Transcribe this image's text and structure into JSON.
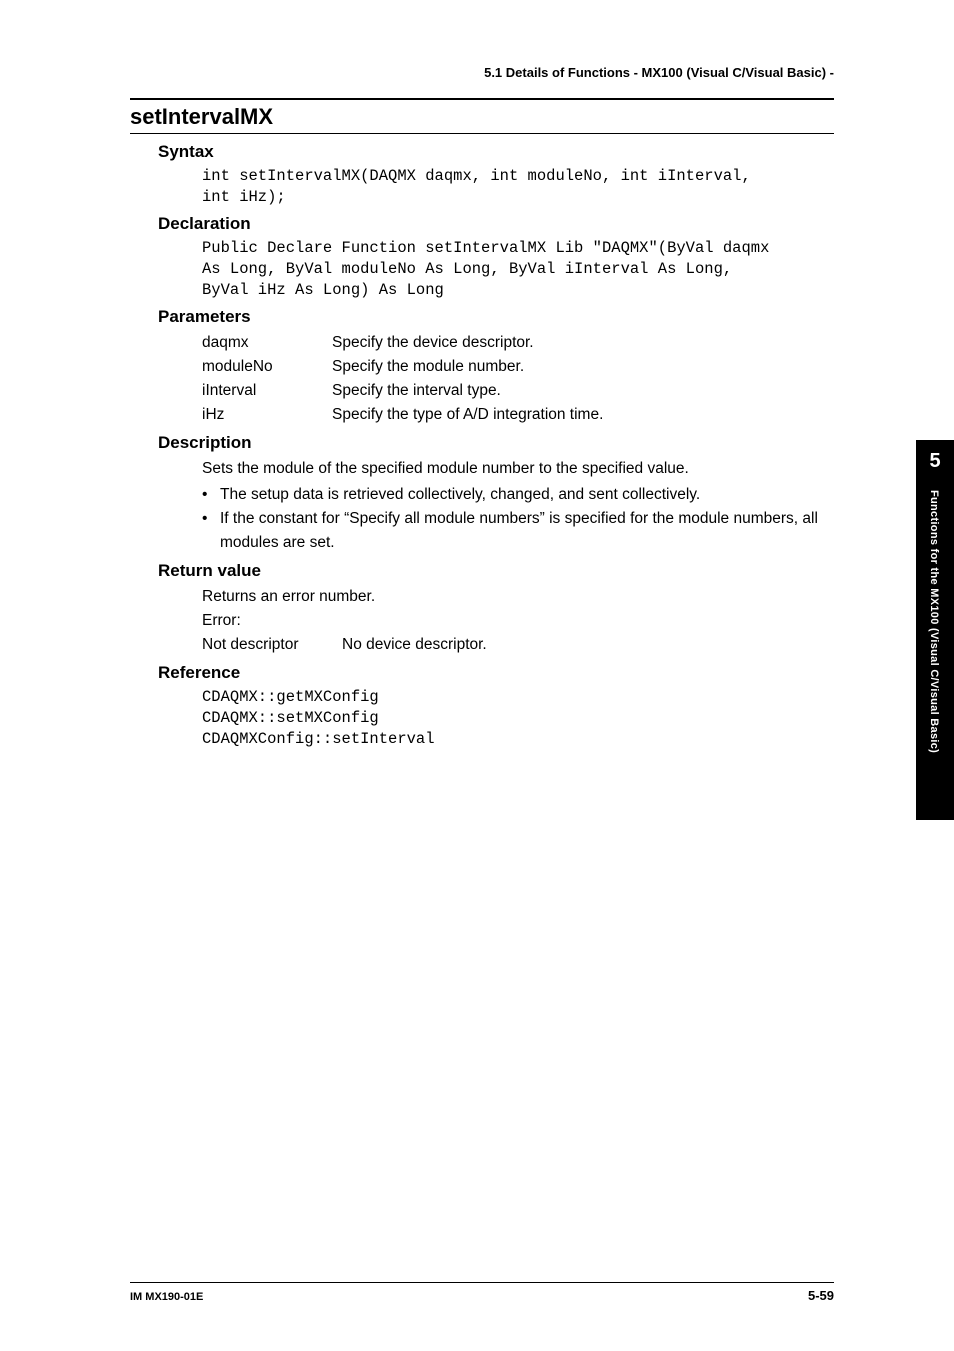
{
  "running_header": "5.1  Details of Functions - MX100 (Visual C/Visual Basic) -",
  "title": "setIntervalMX",
  "sections": {
    "syntax": {
      "heading": "Syntax",
      "code": "int setIntervalMX(DAQMX daqmx, int moduleNo, int iInterval,\nint iHz);"
    },
    "declaration": {
      "heading": "Declaration",
      "code": "Public Declare Function setIntervalMX Lib \"DAQMX\"(ByVal daqmx\nAs Long, ByVal moduleNo As Long, ByVal iInterval As Long,\nByVal iHz As Long) As Long"
    },
    "parameters": {
      "heading": "Parameters",
      "rows": [
        {
          "name": "daqmx",
          "desc": "Specify the device descriptor."
        },
        {
          "name": "moduleNo",
          "desc": "Specify the module number."
        },
        {
          "name": "iInterval",
          "desc": "Specify the interval type."
        },
        {
          "name": "iHz",
          "desc": "Specify the type of A/D integration time."
        }
      ]
    },
    "description": {
      "heading": "Description",
      "intro": "Sets the module of the specified module number to the specified value.",
      "bullets": [
        "The setup data is retrieved collectively, changed, and sent collectively.",
        "If the constant for “Specify all module numbers” is specified for the module numbers, all modules are set."
      ]
    },
    "return_value": {
      "heading": "Return value",
      "line1": "Returns an error number.",
      "line2": "Error:",
      "error_name": "Not descriptor",
      "error_desc": "No device descriptor."
    },
    "reference": {
      "heading": "Reference",
      "code": "CDAQMX::getMXConfig\nCDAQMX::setMXConfig\nCDAQMXConfig::setInterval"
    }
  },
  "sidebar": {
    "chapter": "5",
    "label": "Functions for the MX100 (Visual C/Visual Basic)"
  },
  "footer": {
    "left": "IM MX190-01E",
    "right": "5-59"
  }
}
